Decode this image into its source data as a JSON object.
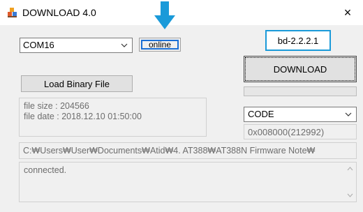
{
  "window": {
    "title": "DOWNLOAD 4.0",
    "close_label": "×"
  },
  "port_select": {
    "value": "COM16",
    "icon": "chevron-down-icon"
  },
  "connection_status": {
    "text": "online",
    "highlight_color": "#1a6fd6"
  },
  "firmware_version": {
    "text": "bd-2.2.2.1",
    "border_color": "#1a9ad9"
  },
  "download_button": {
    "label": "DOWNLOAD"
  },
  "progress": {
    "value": 0
  },
  "load_button": {
    "label": "Load Binary File"
  },
  "file_info": {
    "size_text": "file size : 204566",
    "date_text": "file date : 2018.12.10 01:50:00"
  },
  "memory_type_select": {
    "value": "CODE",
    "icon": "chevron-down-icon"
  },
  "address": {
    "text": "0x008000(212992)"
  },
  "file_path": {
    "text": "C:₩Users₩User₩Documents₩Atid₩4. AT388₩AT388N Firmware Note₩"
  },
  "log": {
    "text": "connected."
  },
  "annotation": {
    "arrow_color": "#1a9ad9",
    "icon": "down-arrow-icon"
  }
}
